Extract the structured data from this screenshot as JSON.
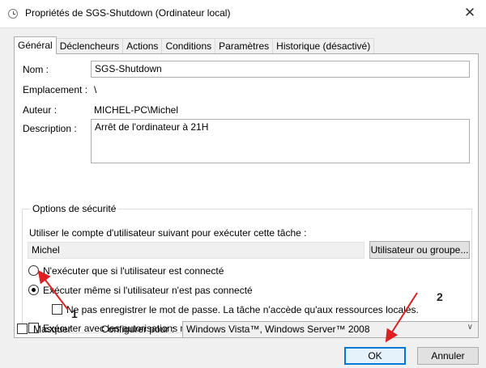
{
  "window": {
    "title": "Propriétés de SGS-Shutdown (Ordinateur local)",
    "close_glyph": "✕"
  },
  "tabs": [
    "Général",
    "Déclencheurs",
    "Actions",
    "Conditions",
    "Paramètres",
    "Historique (désactivé)"
  ],
  "general": {
    "name_label": "Nom :",
    "name_value": "SGS-Shutdown",
    "location_label": "Emplacement :",
    "location_value": "\\",
    "author_label": "Auteur :",
    "author_value": "MICHEL-PC\\Michel",
    "description_label": "Description :",
    "description_value": "Arrêt de l'ordinateur à 21H"
  },
  "security": {
    "legend": "Options de sécurité",
    "account_prompt": "Utiliser le compte d'utilisateur suivant pour exécuter cette tâche :",
    "account_value": "Michel",
    "user_group_button": "Utilisateur ou groupe...",
    "radio_logged_on": "N'exécuter que si l'utilisateur est connecté",
    "radio_any": "Exécuter même si l'utilisateur n'est pas connecté",
    "no_store_password": "Ne pas enregistrer le mot de passe. La tâche n'accède qu'aux ressources locales.",
    "highest_privileges": "Exécuter avec les autorisations maximales"
  },
  "footer": {
    "hidden_label": "Masquer",
    "configure_label": "Configurer pour :",
    "configure_value": "Windows Vista™, Windows Server™ 2008",
    "ok_label": "OK",
    "cancel_label": "Annuler"
  },
  "annotations": {
    "marker_1": "1",
    "marker_2": "2",
    "arrow_color": "#e02020"
  }
}
